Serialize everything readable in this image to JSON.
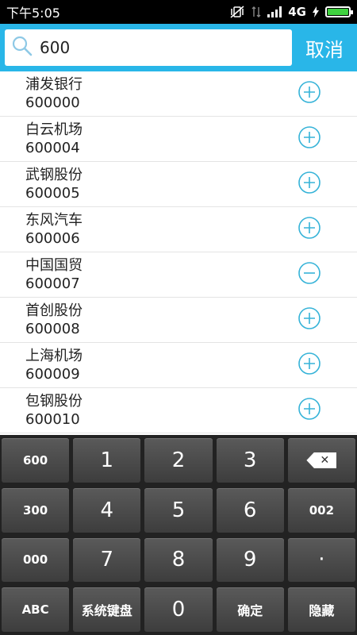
{
  "status_bar": {
    "time": "下午5:05",
    "network": "4G"
  },
  "search": {
    "query": "600",
    "cancel_label": "取消"
  },
  "stocks": [
    {
      "name": "浦发银行",
      "code": "600000",
      "added": false
    },
    {
      "name": "白云机场",
      "code": "600004",
      "added": false
    },
    {
      "name": "武钢股份",
      "code": "600005",
      "added": false
    },
    {
      "name": "东风汽车",
      "code": "600006",
      "added": false
    },
    {
      "name": "中国国贸",
      "code": "600007",
      "added": true
    },
    {
      "name": "首创股份",
      "code": "600008",
      "added": false
    },
    {
      "name": "上海机场",
      "code": "600009",
      "added": false
    },
    {
      "name": "包钢股份",
      "code": "600010",
      "added": false
    }
  ],
  "keyboard": {
    "rows": [
      [
        "600",
        "1",
        "2",
        "3",
        "⌫"
      ],
      [
        "300",
        "4",
        "5",
        "6",
        "002"
      ],
      [
        "000",
        "7",
        "8",
        "9",
        "·"
      ],
      [
        "ABC",
        "系统键盘",
        "0",
        "确定",
        "隐藏"
      ]
    ]
  },
  "colors": {
    "accent": "#29b6e8",
    "icon": "#36b3d8"
  }
}
